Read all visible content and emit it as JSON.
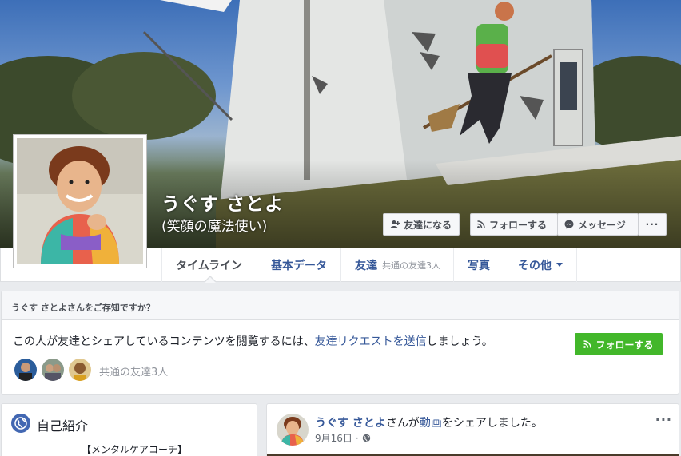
{
  "profile": {
    "name": "うぐす さとよ",
    "subname": "(笑顔の魔法使い)"
  },
  "cover_buttons": {
    "add_friend": "友達になる",
    "follow": "フォローする",
    "message": "メッセージ",
    "more": "···"
  },
  "nav": {
    "tabs": [
      {
        "label": "タイムライン"
      },
      {
        "label": "基本データ"
      },
      {
        "label": "友達",
        "sub": "共通の友達3人"
      },
      {
        "label": "写真"
      },
      {
        "label": "その他"
      }
    ]
  },
  "know_card": {
    "header": "うぐす さとよさんをご存知ですか？",
    "text_before": "この人が友達とシェアしているコンテンツを閲覧するには、",
    "link": "友達リクエストを送信",
    "text_after": "しましょう。",
    "follow_button": "フォローする",
    "mutual_friends": "共通の友達3人"
  },
  "intro": {
    "title": "自己紹介",
    "line1": "【メンタルケアコーチ】"
  },
  "post": {
    "author": "うぐす さとよ",
    "text_mid": "さんが",
    "link": "動画",
    "text_after": "をシェアしました。",
    "date": "9月16日",
    "dot": "·",
    "more": "···"
  },
  "icons": {
    "add_friend": "add-friend-icon",
    "follow": "rss-icon",
    "message": "messenger-icon",
    "privacy": "globe-icon",
    "intro": "globe-icon"
  },
  "colors": {
    "link": "#365899",
    "green": "#42b72a",
    "background": "#e9ebee"
  }
}
